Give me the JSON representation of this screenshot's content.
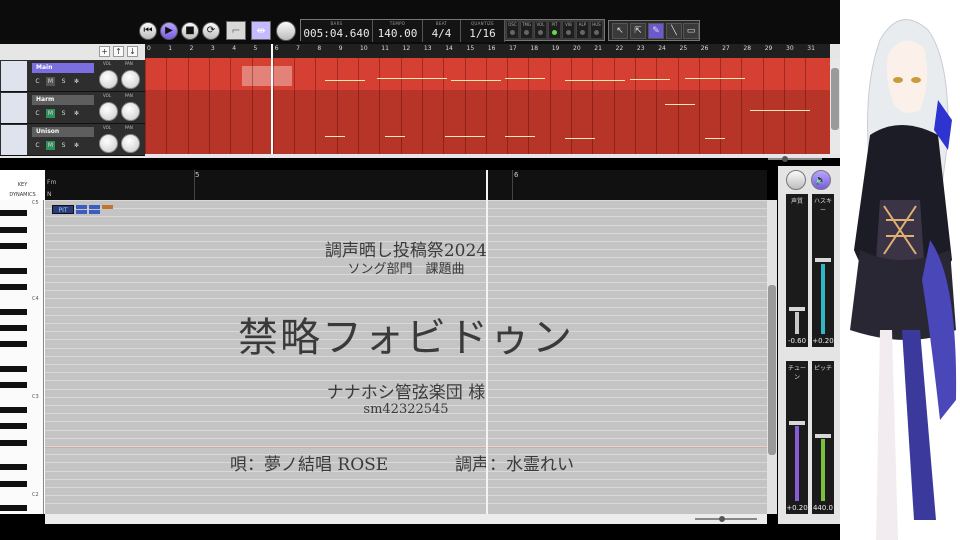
{
  "transport": {
    "bars_label": "BARS",
    "bars_value": "005:04.640",
    "tempo_label": "TEMPO",
    "tempo_value": "140.00",
    "beat_label": "BEAT",
    "beat_value": "4/4",
    "quantize_label": "QUANTIZE",
    "quantize_value": "1/16",
    "toggles": [
      "OSC",
      "TMG",
      "VOL",
      "PIT",
      "VIB",
      "ALP",
      "HUS"
    ],
    "active_toggle": "PIT"
  },
  "ruler": {
    "bars": [
      "0",
      "1",
      "2",
      "3",
      "4",
      "5",
      "6",
      "7",
      "8",
      "9",
      "10",
      "11",
      "12",
      "13",
      "14",
      "15",
      "16",
      "17",
      "18",
      "19",
      "20",
      "21",
      "22",
      "23",
      "24",
      "25",
      "26",
      "27",
      "28",
      "29",
      "30",
      "31"
    ]
  },
  "tracks": [
    {
      "name": "Main",
      "c": "C",
      "m": "M",
      "s": "S",
      "vol_label": "VOL",
      "pan_label": "PAN",
      "selected": true
    },
    {
      "name": "Harm",
      "c": "C",
      "m": "M",
      "s": "S",
      "vol_label": "VOL",
      "pan_label": "PAN",
      "selected": false
    },
    {
      "name": "Unison",
      "c": "C",
      "m": "M",
      "s": "S",
      "vol_label": "VOL",
      "pan_label": "PAN",
      "selected": false
    }
  ],
  "track_toolbar": {
    "add": "+",
    "up": "↑",
    "down": "↓"
  },
  "piano": {
    "key_label": "KEY",
    "dynamics_label": "DYNAMICS",
    "fm_label": "Fm",
    "n_label": "N",
    "octaves": [
      "C5",
      "C4",
      "C3",
      "C2"
    ]
  },
  "roll_ruler": {
    "marks": [
      "5",
      "6"
    ]
  },
  "pit_badge": "PIT",
  "overlay": {
    "line1": "調声晒し投稿祭2024",
    "line2": "ソング部門　課題曲",
    "title": "禁略フォビドゥン",
    "artist": "ナナホシ管弦楽団 様",
    "id": "sm42322545",
    "vocal": "唄：夢ノ結唱 ROSE",
    "tuner": "調声：水霊れい"
  },
  "mixer": {
    "channels": [
      {
        "label": "声質",
        "value": "-0.60"
      },
      {
        "label": "ハスキー",
        "value": "+0.20"
      },
      {
        "label": "チューン",
        "value": "+0.20"
      },
      {
        "label": "ピッチ",
        "value": "440.0"
      }
    ]
  },
  "colors": {
    "track_red": "#d54032",
    "accent_purple": "#7b6ee0",
    "roll_gray": "#c4c4c4"
  }
}
